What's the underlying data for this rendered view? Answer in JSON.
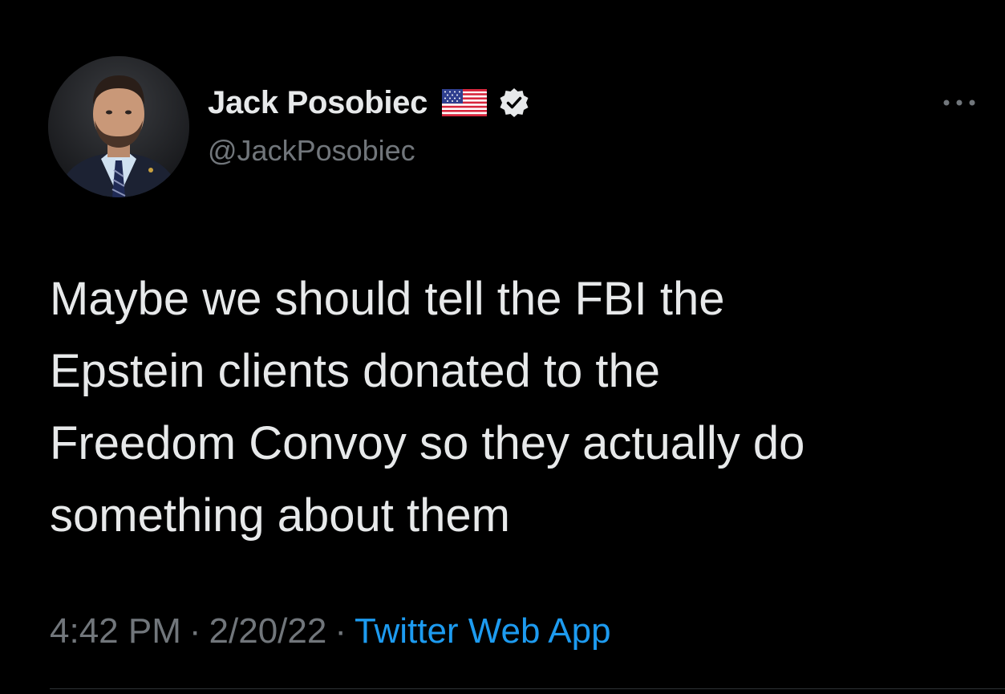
{
  "author": {
    "display_name": "Jack Posobiec",
    "handle": "@JackPosobiec",
    "flag_icon": "us-flag-icon",
    "verified_icon": "verified-badge-icon",
    "verified_color": "#e7e9ea"
  },
  "menu": {
    "icon": "more-options-icon"
  },
  "tweet": {
    "lines": [
      "Maybe we should tell the FBI the",
      "Epstein clients donated to the",
      "Freedom Convoy so they actually do",
      "something about them"
    ]
  },
  "meta": {
    "time": "4:42 PM",
    "separator": "·",
    "date": "2/20/22",
    "source": "Twitter Web App"
  },
  "colors": {
    "background": "#000000",
    "text": "#e7e9ea",
    "muted": "#71767b",
    "link": "#1d9bf0"
  }
}
